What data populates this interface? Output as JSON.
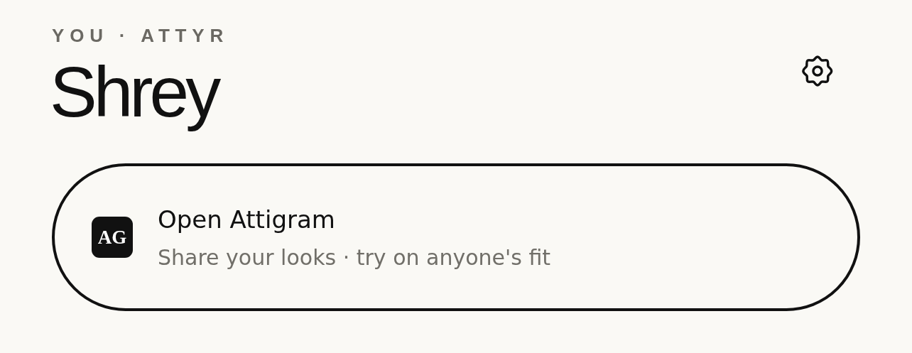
{
  "header": {
    "eyebrow": "YOU · ATTYR",
    "name": "Shrey"
  },
  "card": {
    "logo": "AG",
    "title": "Open Attigram",
    "subtitle": "Share your looks · try on anyone's fit"
  }
}
